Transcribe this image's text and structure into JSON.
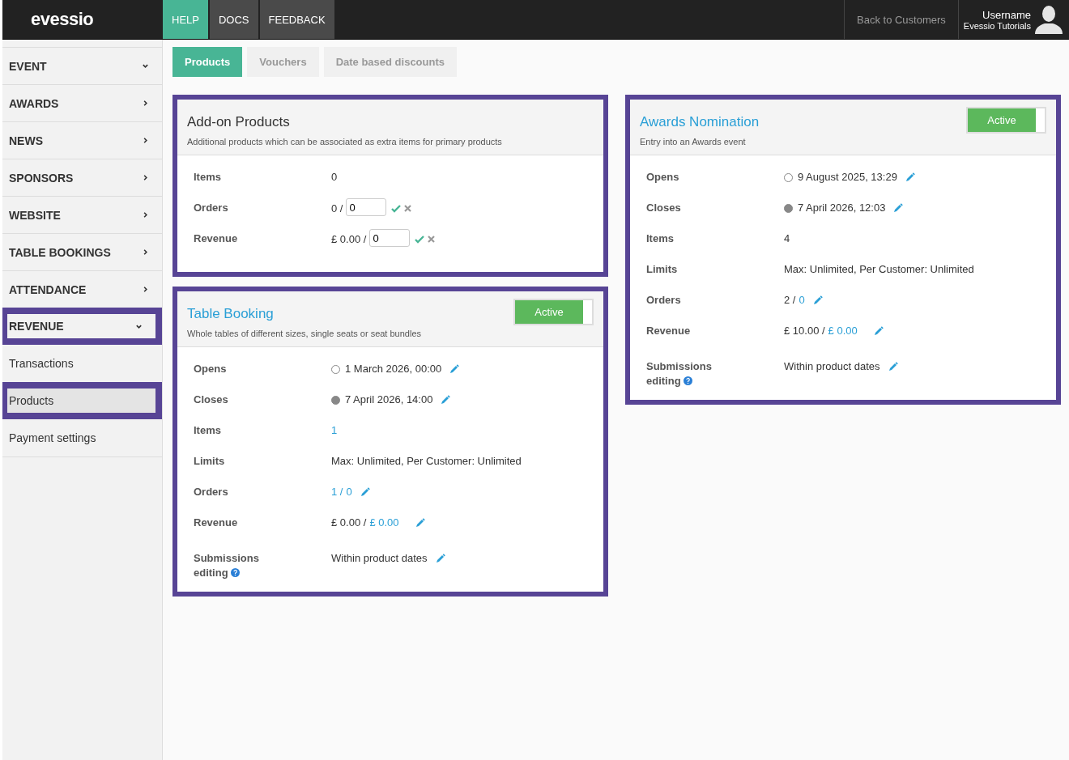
{
  "header": {
    "logo": "evessio",
    "nav": [
      {
        "label": "HELP",
        "selected": true
      },
      {
        "label": "DOCS",
        "selected": false
      },
      {
        "label": "FEEDBACK",
        "selected": false
      }
    ],
    "back_link": "Back to Customers",
    "user": {
      "name": "Username",
      "org": "Evessio Tutorials"
    }
  },
  "sidebar": {
    "items": [
      {
        "label": "EVENT",
        "expanded": true,
        "highlighted": false
      },
      {
        "label": "AWARDS",
        "expanded": false,
        "highlighted": false
      },
      {
        "label": "NEWS",
        "expanded": false,
        "highlighted": false
      },
      {
        "label": "SPONSORS",
        "expanded": false,
        "highlighted": false
      },
      {
        "label": "WEBSITE",
        "expanded": false,
        "highlighted": false
      },
      {
        "label": "TABLE BOOKINGS",
        "expanded": false,
        "highlighted": false
      },
      {
        "label": "ATTENDANCE",
        "expanded": false,
        "highlighted": false
      },
      {
        "label": "REVENUE",
        "expanded": true,
        "highlighted": true,
        "children": [
          {
            "label": "Transactions",
            "selected": false,
            "highlighted": false
          },
          {
            "label": "Products",
            "selected": true,
            "highlighted": true
          },
          {
            "label": "Payment settings",
            "selected": false,
            "highlighted": false
          }
        ]
      }
    ]
  },
  "tabs": [
    {
      "label": "Products",
      "selected": true
    },
    {
      "label": "Vouchers",
      "selected": false
    },
    {
      "label": "Date based discounts",
      "selected": false
    }
  ],
  "columns": [
    {
      "cards": [
        {
          "title": "Add-on Products",
          "title_link": false,
          "description": "Additional products which can be associated as extra items for primary products",
          "highlighted": true,
          "rows": [
            {
              "label": "Items",
              "kind": "plain",
              "value": "0"
            },
            {
              "label": "Orders",
              "kind": "input",
              "value": "0 /",
              "input": "0"
            },
            {
              "label": "Revenue",
              "kind": "input",
              "value": "£ 0.00 /",
              "input": "0"
            }
          ]
        },
        {
          "title": "Table Booking",
          "title_link": true,
          "description": "Whole tables of different sizes, single seats or seat bundles",
          "highlighted": true,
          "toggle": {
            "label": "Active",
            "on": true
          },
          "rows": [
            {
              "label": "Opens",
              "kind": "date",
              "closed": false,
              "value": "1 March 2026, 00:00"
            },
            {
              "label": "Closes",
              "kind": "date",
              "closed": true,
              "value": "7 April 2026, 14:00"
            },
            {
              "label": "Items",
              "kind": "plain",
              "value": "1",
              "value_link": true
            },
            {
              "label": "Limits",
              "kind": "plain",
              "value": "Max: Unlimited, Per Customer: Unlimited"
            },
            {
              "label": "Orders",
              "kind": "editable",
              "value": "1 /",
              "link": "0",
              "value_link": true
            },
            {
              "label": "Revenue",
              "kind": "editable",
              "value": "£ 0.00 /",
              "link": "£ 0.00"
            },
            {
              "label": "Submissions editing",
              "help": true,
              "kind": "editable",
              "value": "Within product dates"
            }
          ]
        }
      ]
    },
    {
      "cards": [
        {
          "title": "Awards Nomination",
          "title_link": true,
          "description": "Entry into an Awards event",
          "highlighted": true,
          "toggle": {
            "label": "Active",
            "on": true
          },
          "rows": [
            {
              "label": "Opens",
              "kind": "date",
              "closed": false,
              "value": "9 August 2025, 13:29"
            },
            {
              "label": "Closes",
              "kind": "date",
              "closed": true,
              "value": "7 April 2026, 12:03"
            },
            {
              "label": "Items",
              "kind": "plain",
              "value": "4"
            },
            {
              "label": "Limits",
              "kind": "plain",
              "value": "Max: Unlimited, Per Customer: Unlimited"
            },
            {
              "label": "Orders",
              "kind": "editable",
              "value": "2 /",
              "link": "0"
            },
            {
              "label": "Revenue",
              "kind": "editable",
              "value": "£ 10.00 /",
              "link": "£ 0.00"
            },
            {
              "label": "Submissions editing",
              "help": true,
              "kind": "editable",
              "value": "Within product dates"
            }
          ]
        }
      ]
    }
  ]
}
